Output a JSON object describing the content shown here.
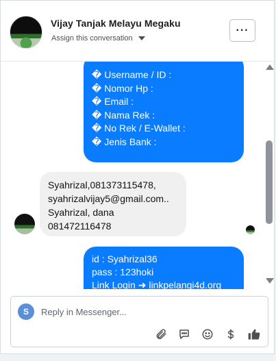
{
  "header": {
    "contact_name": "Vijay Tanjak Melayu Megaku",
    "assign_label": "Assign this conversation",
    "more_button_label": "···"
  },
  "messages": {
    "outgoing_1_lines": [
      "� Username / ID :",
      "� Nomor Hp :",
      "� Email :",
      "� Nama Rek :",
      "� No Rek / E-Wallet :",
      "� Jenis Bank :"
    ],
    "incoming_lines": [
      "Syahrizal,081373115478,",
      "syahrizalvijay5@gmail.com..",
      "Syahrizal, dana",
      "081472116478"
    ],
    "outgoing_2_lines": [
      "id : Syahrizal36",
      "pass : 123hoki",
      "Link Login ➜ linkpelangi4d.org"
    ]
  },
  "composer": {
    "user_initial": "S",
    "placeholder": "Reply in Messenger..."
  },
  "icons": {
    "attach": "paperclip-icon",
    "saved_replies": "chat-bubble-icon",
    "emoji": "smiley-icon",
    "payment": "dollar-icon",
    "like": "thumbs-up-icon"
  },
  "colors": {
    "outgoing_bubble": "#0a7cff",
    "incoming_bubble": "#f0f0f0",
    "user_avatar": "#5b8fd9"
  }
}
